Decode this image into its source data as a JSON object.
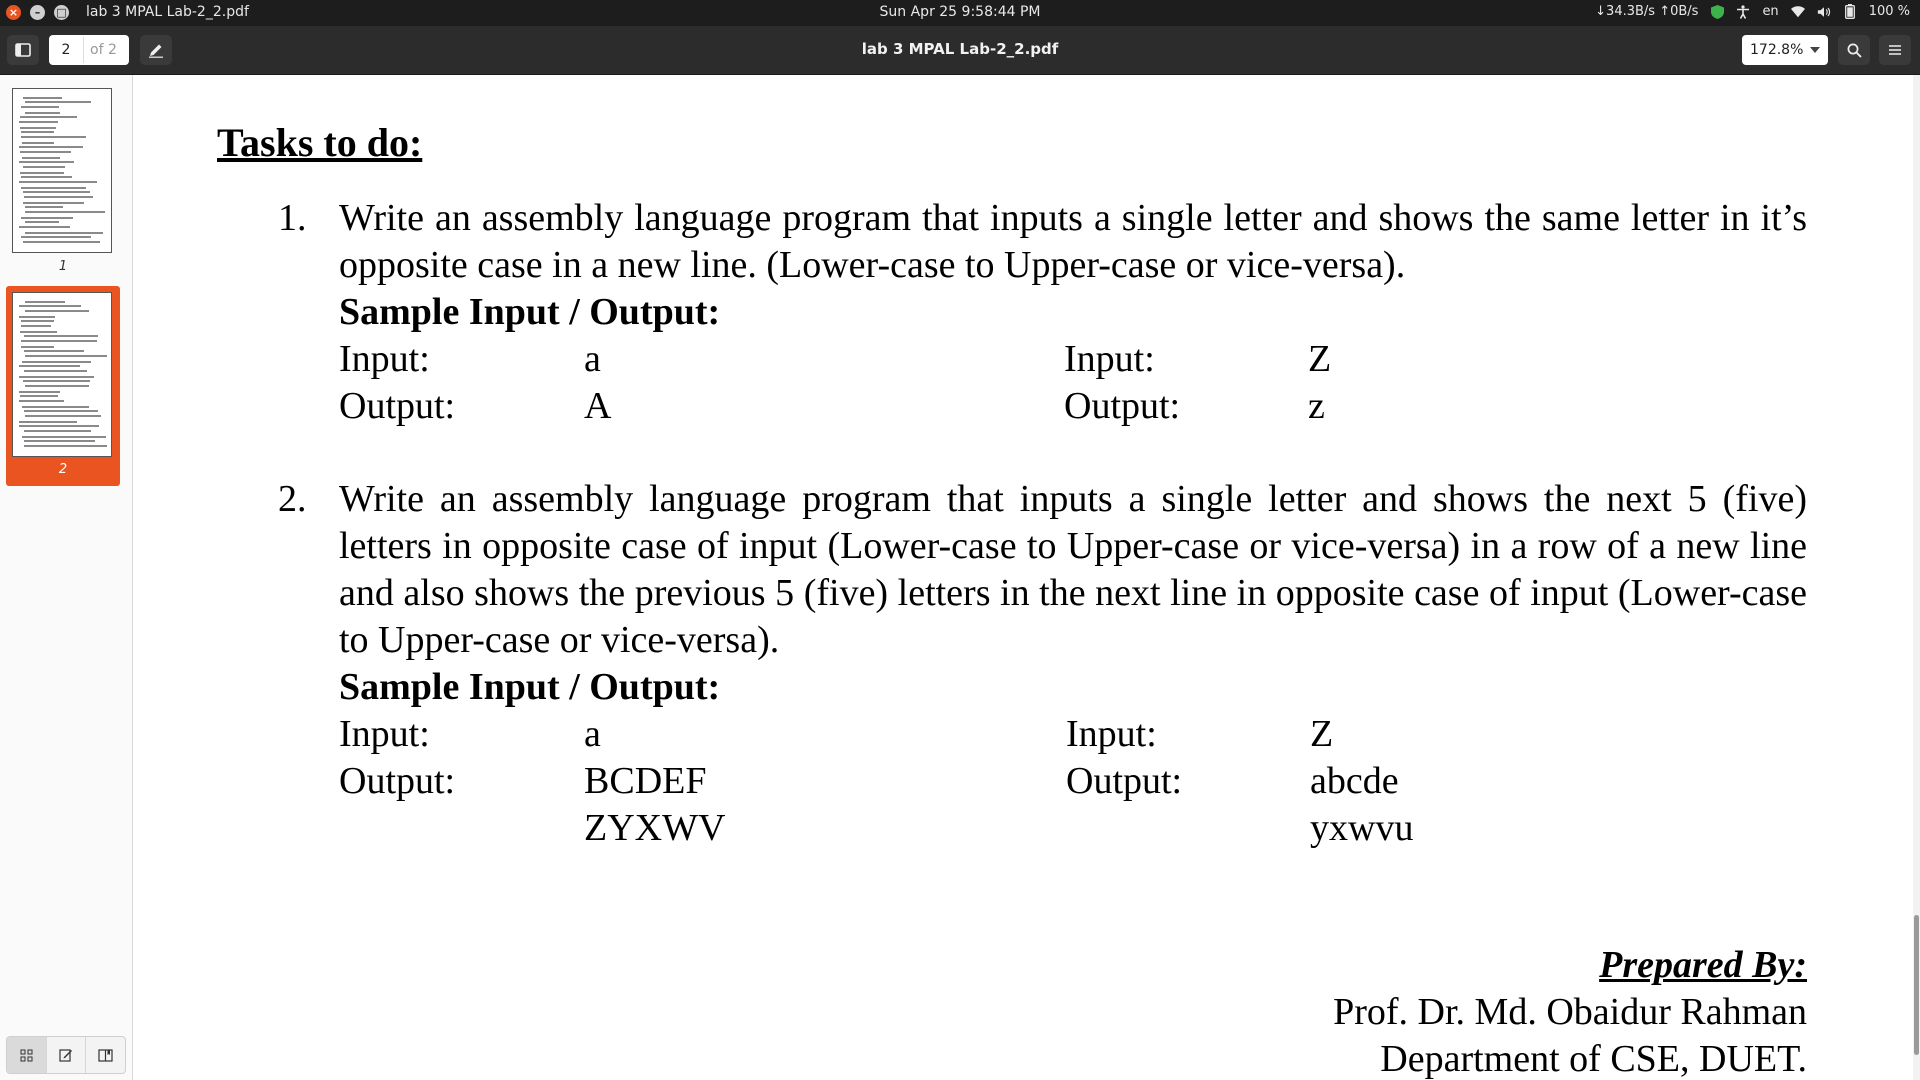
{
  "system_bar": {
    "window_title": "lab 3 MPAL Lab-2_2.pdf",
    "clock": "Sun Apr 25  9:58:44 PM",
    "net_speed": "↓34.3B/s ↑0B/s",
    "language": "en",
    "battery": "100 %"
  },
  "toolbar": {
    "page_current": "2",
    "page_total": "of 2",
    "doc_title": "lab 3 MPAL Lab-2_2.pdf",
    "zoom": "172.8%"
  },
  "sidebar": {
    "thumbnails": [
      {
        "label": "1"
      },
      {
        "label": "2"
      }
    ]
  },
  "document": {
    "heading": "Tasks to do:",
    "tasks": [
      {
        "number": "1.",
        "text": "Write an assembly language program that inputs a single letter and shows the same letter in it’s opposite case in a new line. (Lower-case to Upper-case or vice-versa).",
        "sample_heading": "Sample Input / Output:",
        "left": {
          "input_label": "Input:",
          "input_value": "a",
          "output_label": "Output:",
          "output_lines": [
            "A"
          ]
        },
        "right": {
          "input_label": "Input:",
          "input_value": "Z",
          "output_label": "Output:",
          "output_lines": [
            "z"
          ]
        }
      },
      {
        "number": "2.",
        "text": "Write an assembly language program that inputs a single letter and shows the next 5 (five) letters in opposite case of input (Lower-case to Upper-case or vice-versa) in a row of a new line and also shows the previous 5 (five) letters in the next line in opposite case of input (Lower-case to Upper-case or vice-versa).",
        "sample_heading": "Sample Input / Output:",
        "left": {
          "input_label": "Input:",
          "input_value": "a",
          "output_label": "Output:",
          "output_lines": [
            "BCDEF",
            "ZYXWV"
          ]
        },
        "right": {
          "input_label": "Input:",
          "input_value": "Z",
          "output_label": "Output:",
          "output_lines": [
            "abcde",
            "yxwvu"
          ]
        }
      }
    ],
    "footer": {
      "prepared_by": "Prepared By:",
      "name": "Prof. Dr. Md. Obaidur Rahman",
      "department": "Department of CSE, DUET."
    }
  }
}
